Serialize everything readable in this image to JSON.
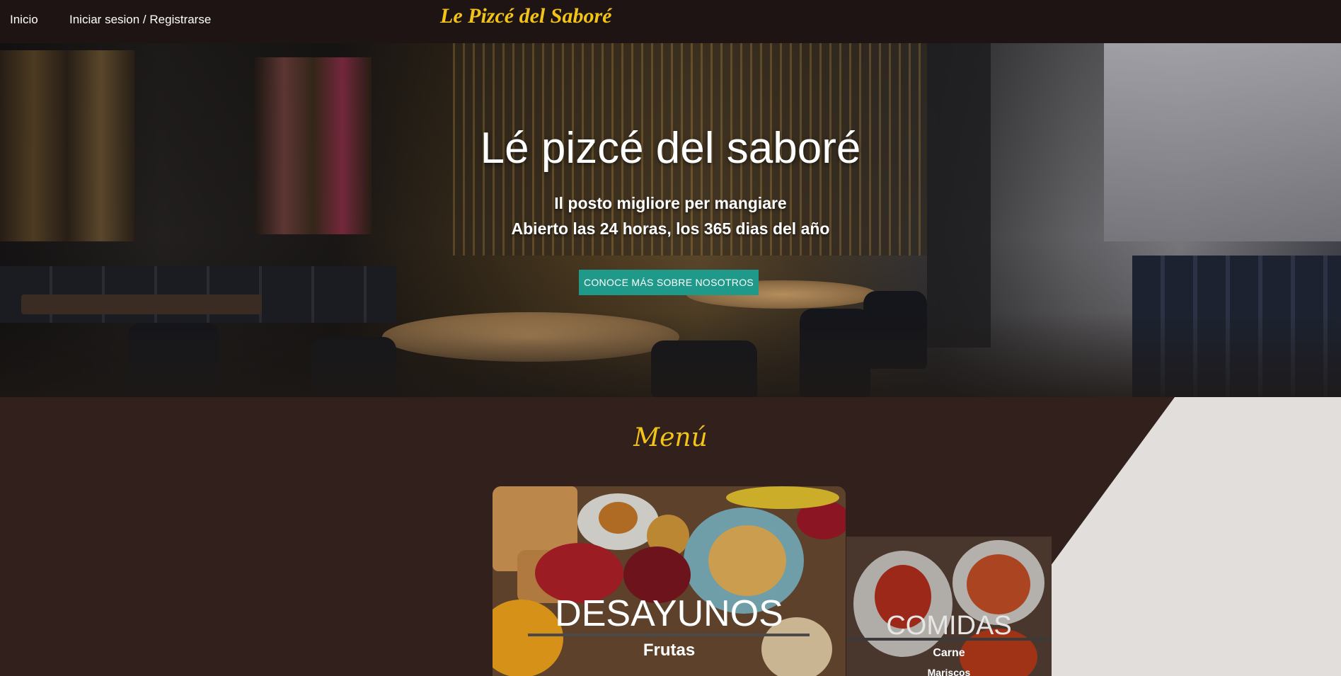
{
  "nav": {
    "home": "Inicio",
    "login": "Iniciar sesion / Registrarse",
    "brand": "Le Pizcé del Saboré"
  },
  "hero": {
    "title": "Lé pizcé del saboré",
    "subtitle1": "Il posto migliore per mangiare",
    "subtitle2": "Abierto las 24 horas, los 365 dias del año",
    "button": "CONOCE MÁS SOBRE NOSOTROS"
  },
  "menu": {
    "title": "Menú",
    "cards": [
      {
        "title": "DESAYUNOS",
        "items": [
          "Frutas"
        ]
      },
      {
        "title": "COMIDAS",
        "items": [
          "Carne",
          "Mariscos"
        ]
      }
    ]
  },
  "colors": {
    "brand": "#f2c418",
    "button": "#1f9a8a",
    "background": "#31201c",
    "topbar": "#1d1413"
  }
}
